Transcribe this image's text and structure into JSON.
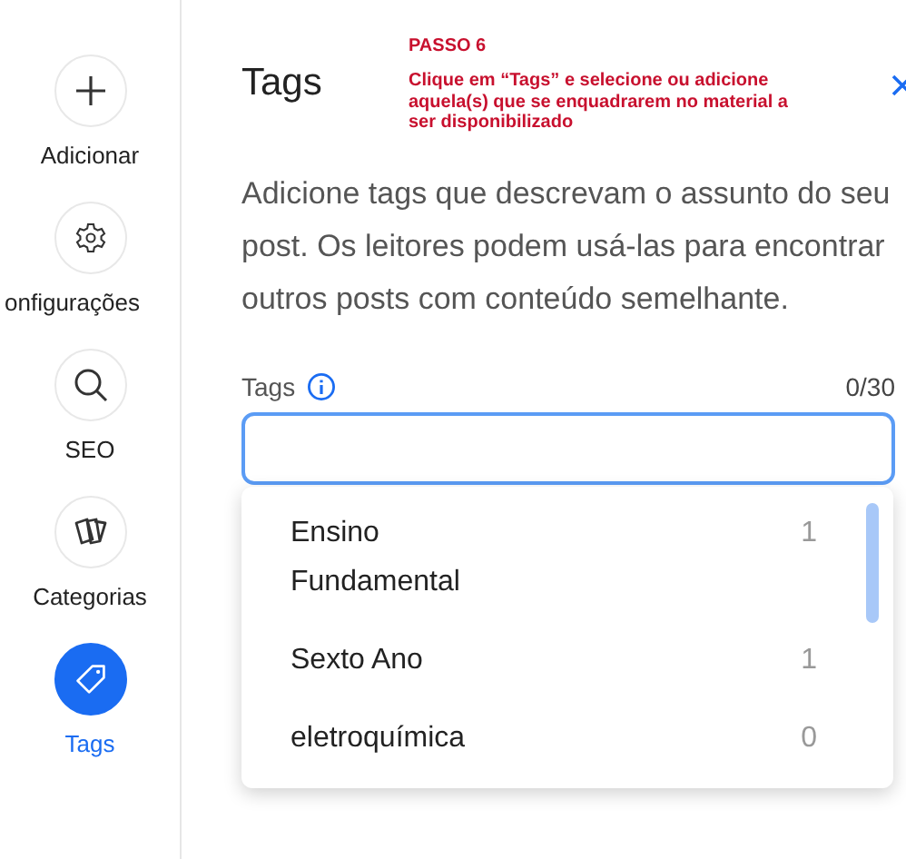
{
  "sidebar": {
    "items": [
      {
        "kind": "add",
        "label": "Adicionar",
        "selected": false
      },
      {
        "kind": "settings",
        "label": "onfigurações",
        "selected": false
      },
      {
        "kind": "seo",
        "label": "SEO",
        "selected": false
      },
      {
        "kind": "categories",
        "label": "Categorias",
        "selected": false
      },
      {
        "kind": "tags",
        "label": "Tags",
        "selected": true
      }
    ]
  },
  "panel": {
    "title": "Tags",
    "annotation": {
      "step": "PASSO 6",
      "text": "Clique em “Tags” e selecione ou adicione aquela(s) que se enquadrarem no material a ser disponibilizado"
    },
    "description": "Adicione tags que descrevam o assunto do seu post. Os leitores podem usá-las para encontrar outros posts com conteúdo semelhante.",
    "field": {
      "label": "Tags",
      "counter": "0/30"
    },
    "suggestions": [
      {
        "name": "Ensino Fundamental",
        "count": "1"
      },
      {
        "name": "Sexto Ano",
        "count": "1"
      },
      {
        "name": "eletroquímica",
        "count": "0"
      }
    ]
  }
}
